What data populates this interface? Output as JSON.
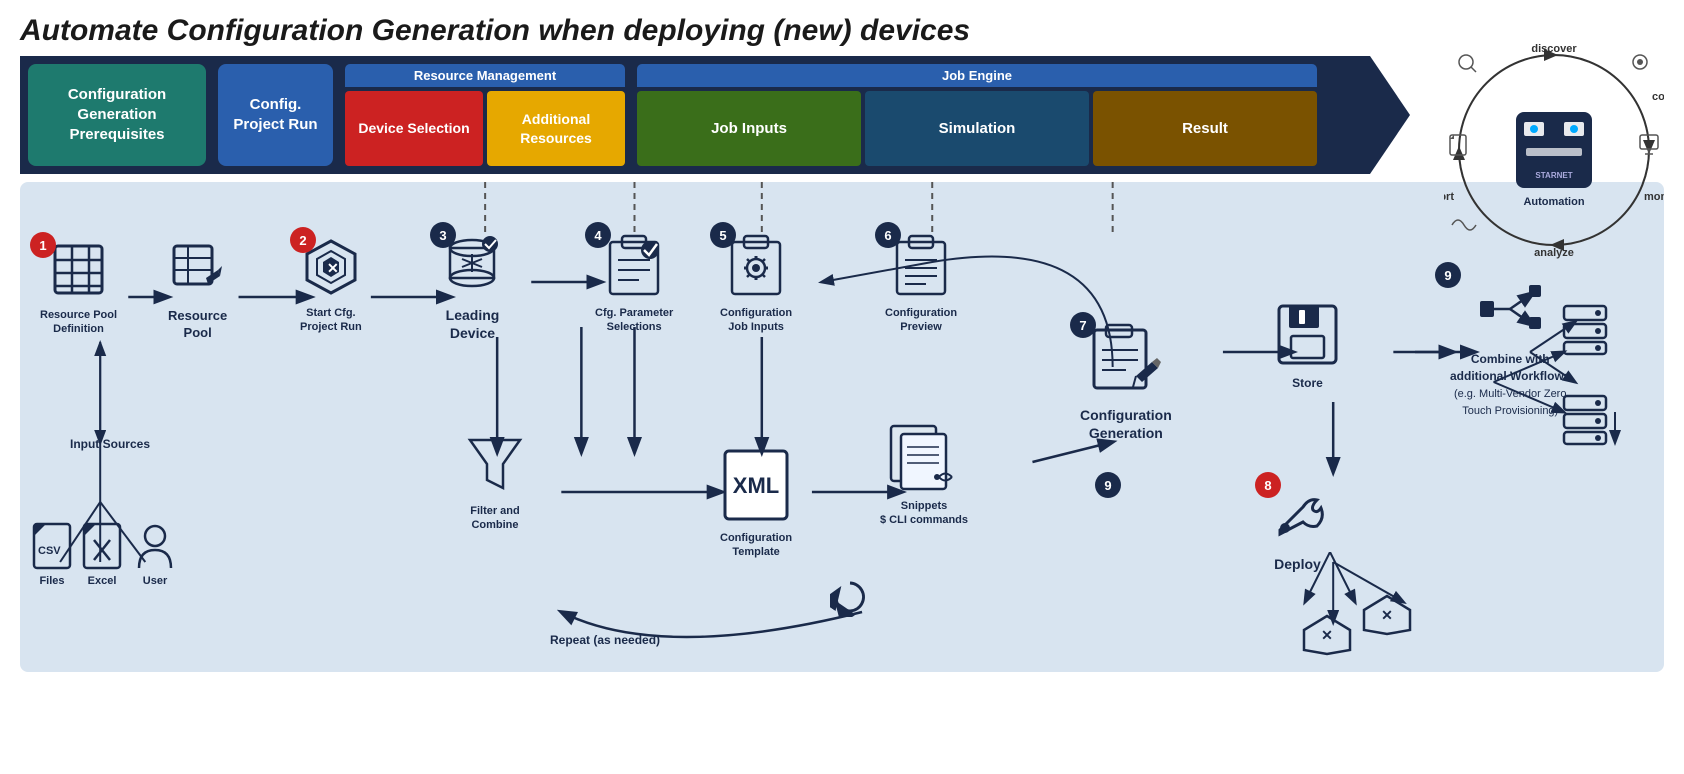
{
  "title": "Automate Configuration Generation when deploying (new) devices",
  "header": {
    "prereq_label": "Configuration Generation Prerequisites",
    "config_project_label": "Config. Project Run",
    "resource_mgmt_label": "Resource Management",
    "device_selection_label": "Device Selection",
    "additional_resources_label": "Additional Resources",
    "job_engine_label": "Job Engine",
    "job_inputs_label": "Job Inputs",
    "simulation_label": "Simulation",
    "result_label": "Result"
  },
  "steps": [
    {
      "id": "1",
      "badge_color": "red",
      "label_line1": "Resource Pool",
      "label_line2": "Definition",
      "sublabel": ""
    },
    {
      "id": "1b",
      "badge_color": "none",
      "label_line1": "Resource Pool",
      "label_line2": "",
      "sublabel": ""
    },
    {
      "id": "2",
      "badge_color": "red",
      "label_line1": "Start Cfg.",
      "label_line2": "Project Run",
      "sublabel": ""
    },
    {
      "id": "3",
      "badge_color": "dark",
      "label_line1": "Leading",
      "label_line2": "Device",
      "sublabel": ""
    },
    {
      "id": "4",
      "badge_color": "dark",
      "label_line1": "Cfg. Parameter",
      "label_line2": "Selections",
      "sublabel": ""
    },
    {
      "id": "4b",
      "badge_color": "none",
      "label_line1": "Filter and",
      "label_line2": "Combine",
      "sublabel": ""
    },
    {
      "id": "5",
      "badge_color": "dark",
      "label_line1": "Configuration",
      "label_line2": "Job Inputs",
      "sublabel": ""
    },
    {
      "id": "5b",
      "badge_color": "none",
      "label_line1": "Configuration",
      "label_line2": "Template",
      "sublabel": ""
    },
    {
      "id": "6",
      "badge_color": "dark",
      "label_line1": "Configuration",
      "label_line2": "Preview",
      "sublabel": ""
    },
    {
      "id": "6b",
      "badge_color": "none",
      "label_line1": "Snippets",
      "label_line2": "$ CLI commands",
      "sublabel": ""
    },
    {
      "id": "7",
      "badge_color": "dark",
      "label_line1": "Configuration",
      "label_line2": "Generation",
      "sublabel": ""
    },
    {
      "id": "8",
      "badge_color": "red",
      "label_line1": "Store",
      "label_line2": "",
      "sublabel": ""
    },
    {
      "id": "8b",
      "badge_color": "red",
      "label_line1": "Deploy",
      "label_line2": "",
      "sublabel": ""
    },
    {
      "id": "9",
      "badge_color": "dark",
      "label_line1": "Combine with additional Workflows",
      "label_line2": "(e.g. Multi-Vendor Zero Touch Provisioning)",
      "sublabel": ""
    }
  ],
  "input_sources": {
    "label": "Input Sources",
    "items": [
      "Files",
      "Excel",
      "User"
    ]
  },
  "repeat_label": "Repeat (as needed)",
  "robot_labels": {
    "discover": "discover",
    "configure": "configure",
    "report": "report",
    "monitor": "monitor",
    "analyze": "analyze",
    "automation": "Automation"
  }
}
